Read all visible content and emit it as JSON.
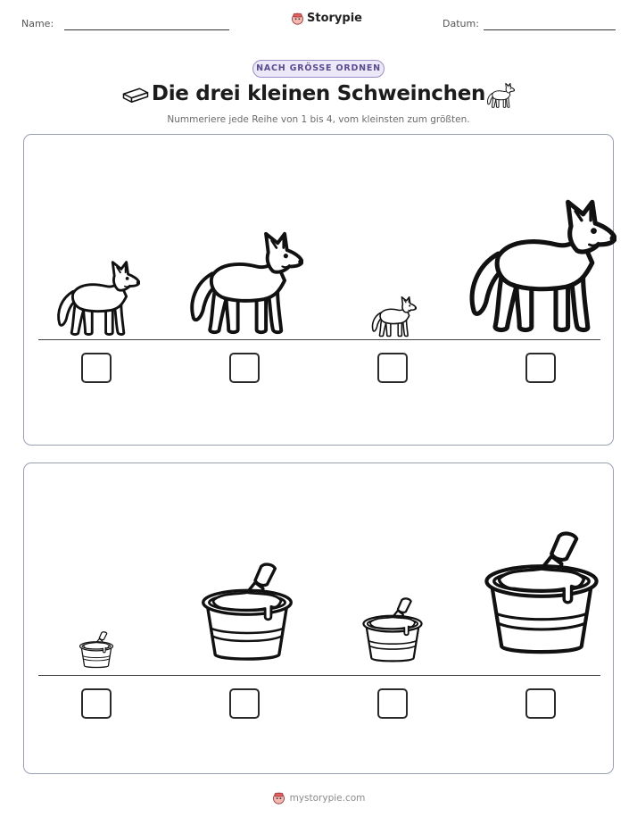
{
  "header": {
    "name_label": "Name:",
    "date_label": "Datum:",
    "brand": "Storypie"
  },
  "badge": "NACH GRÖSSE ORDNEN",
  "title": "Die drei kleinen Schweinchen",
  "title_icons": [
    "brick-icon",
    "wolf-icon"
  ],
  "instruction": "Nummeriere jede Reihe von 1 bis 4, vom kleinsten zum größten.",
  "rows": [
    {
      "subject": "wolf",
      "icons": [
        "wolf-icon",
        "wolf-icon",
        "wolf-icon",
        "wolf-icon"
      ],
      "answers": [
        "",
        "",
        "",
        ""
      ]
    },
    {
      "subject": "bucket",
      "icons": [
        "mortar-bucket-icon",
        "mortar-bucket-icon",
        "mortar-bucket-icon",
        "mortar-bucket-icon"
      ],
      "answers": [
        "",
        "",
        "",
        ""
      ]
    }
  ],
  "footer": {
    "site": "mystorypie.com"
  },
  "colors": {
    "badge_border": "#9b8ec7",
    "badge_fill": "#ece8f7",
    "badge_text": "#5a4c8f",
    "panel_border": "#9aa0b4"
  }
}
